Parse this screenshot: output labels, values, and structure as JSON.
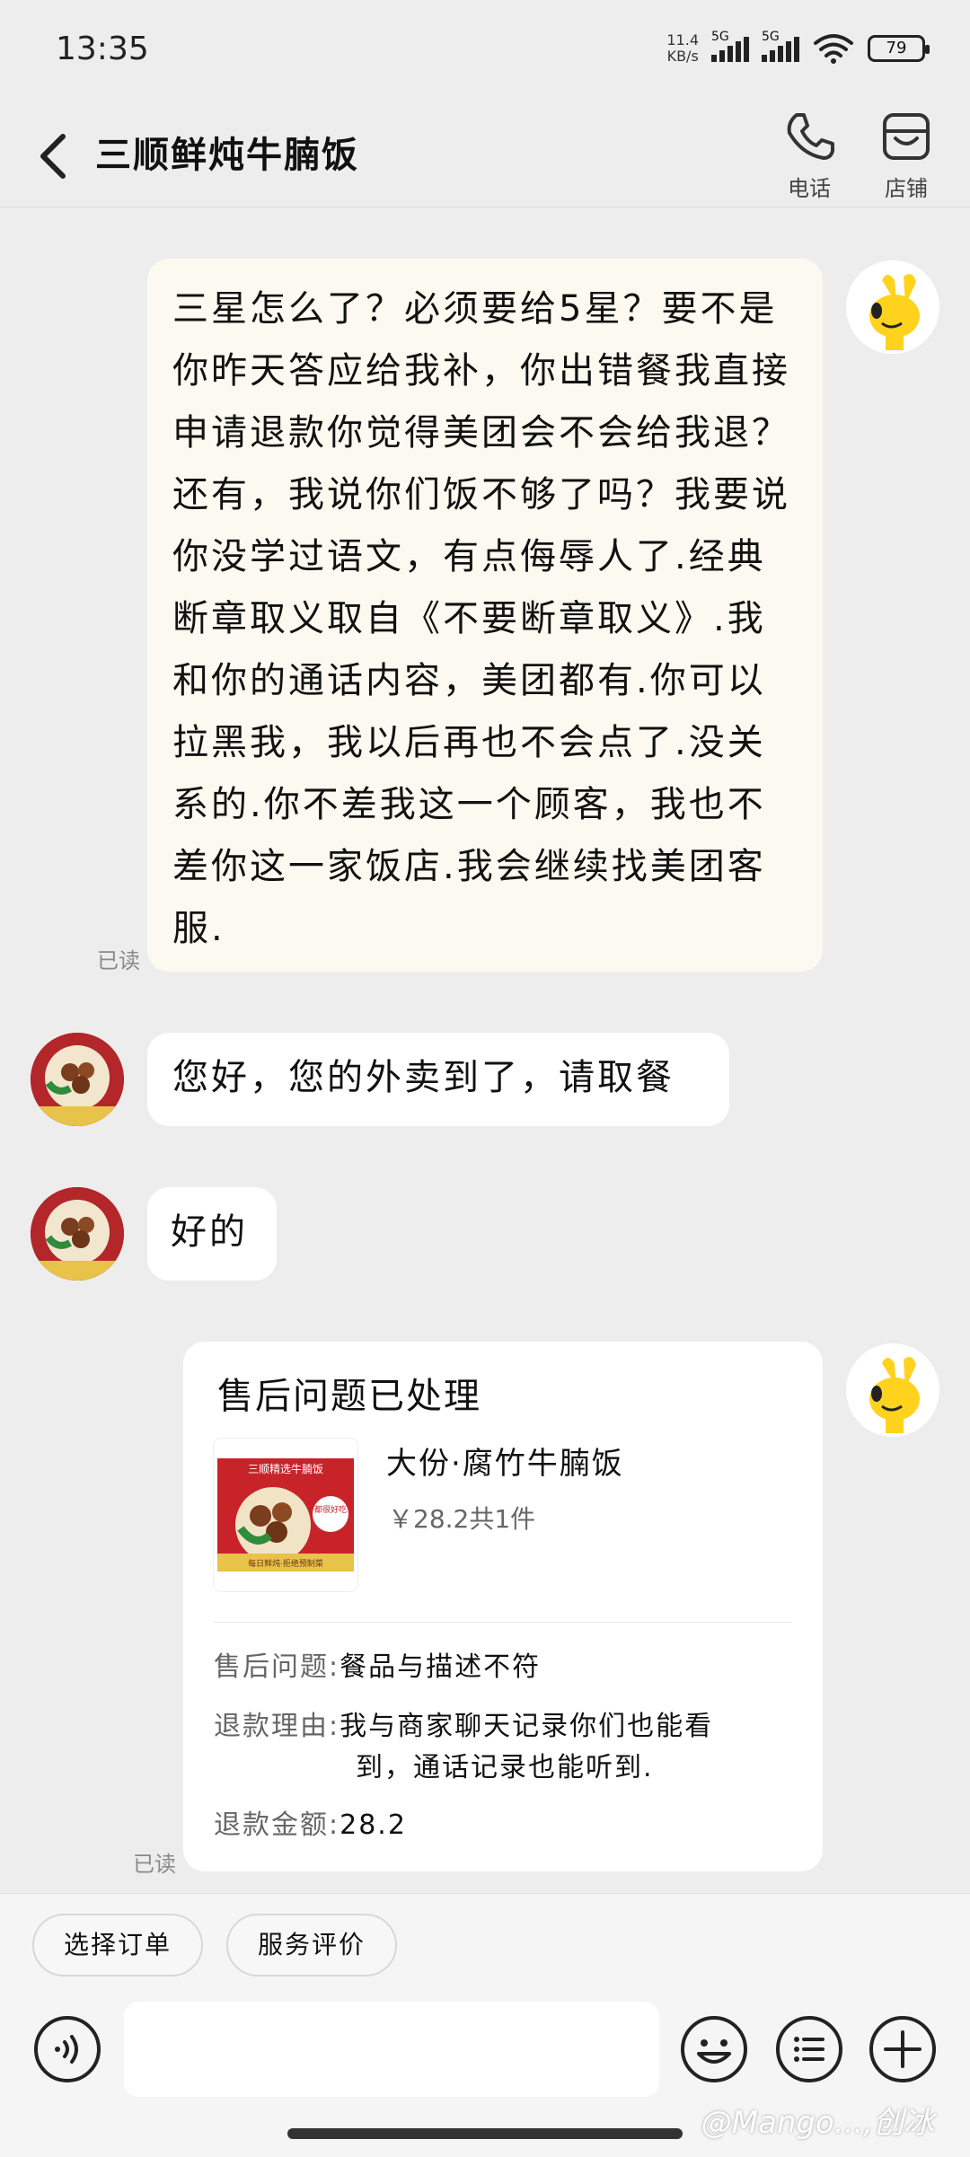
{
  "status_bar": {
    "time": "13:35",
    "net_speed": "11.4",
    "net_speed_unit": "KB/s",
    "signal1_label": "5G",
    "signal2_label": "5G",
    "battery": "79"
  },
  "header": {
    "title": "三顺鲜炖牛腩饭",
    "phone_label": "电话",
    "shop_label": "店铺"
  },
  "messages": [
    {
      "text": "三星怎么了？必须要给5星？要不是你昨天答应给我补，你出错餐我直接申请退款你觉得美团会不会给我退？还有，我说你们饭不够了吗？我要说你没学过语文，有点侮辱人了.经典断章取义取自《不要断章取义》.我和你的通话内容，美团都有.你可以拉黑我，我以后再也不会点了.没关系的.你不差我这一个顾客，我也不差你这一家饭店.我会继续找美团客服.",
      "read": "已读"
    },
    {
      "text": "您好，您的外卖到了，请取餐"
    },
    {
      "text": "好的"
    }
  ],
  "aftersale_card": {
    "title": "售后问题已处理",
    "thumb_banner": "三顺精选牛腩饭",
    "thumb_badge": "都很好吃",
    "thumb_footer": "每日鲜炖·拒绝预制菜",
    "product_name": "大份·腐竹牛腩饭",
    "product_price": "￥28.2共1件",
    "issue_key": "售后问题:",
    "issue_value": "餐品与描述不符",
    "reason_key": "退款理由:",
    "reason_value_line1": "我与商家聊天记录你们也能看",
    "reason_value_line2": "到，通话记录也能听到.",
    "amount_key": "退款金额:",
    "amount_value": "28.2",
    "read": "已读"
  },
  "bottom": {
    "chip_select_order": "选择订单",
    "chip_service_review": "服务评价",
    "input_placeholder": ""
  },
  "watermark": "@Mango...,创冰",
  "colors": {
    "background": "#ededed",
    "user_bubble": "#fcfaf0",
    "store_bubble": "#ffffff",
    "mascot_yellow": "#ffd21e"
  }
}
